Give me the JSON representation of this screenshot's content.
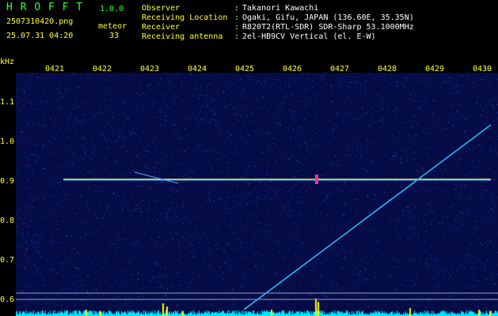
{
  "header": {
    "app_title": "H R O F F T",
    "version": "1.0.0",
    "file_name": "2507310420.png",
    "detection_label": "meteor",
    "timestamp": "25.07.31 04:20",
    "detection_count": "33",
    "info": [
      {
        "key": "Observer",
        "sep": ":",
        "value": "Takanori Kawachi"
      },
      {
        "key": "Receiving Location",
        "sep": ":",
        "value": "Ogaki, Gifu, JAPAN (136.60E, 35.35N)"
      },
      {
        "key": "Receiver",
        "sep": ":",
        "value": "R820T2(RTL-SDR) SDR-Sharp 53.1000MHz"
      },
      {
        "key": "Receiving antenna",
        "sep": ":",
        "value": "2el-HB9CV Vertical (el. E-W)"
      }
    ]
  },
  "axes": {
    "y_unit": "kHz",
    "y_ticks": [
      "1.1",
      "1.0",
      "0.9",
      "0.8",
      "0.7",
      "0.6"
    ],
    "x_ticks": [
      "0421",
      "0422",
      "0423",
      "0424",
      "0425",
      "0426",
      "0427",
      "0428",
      "0429",
      "0430"
    ]
  },
  "colors": {
    "background": "#000000",
    "plot_bg": "#050c45",
    "header_green": "#33ff33",
    "header_yellow": "#ffff33",
    "trace": "#2fb8ff",
    "noise_cyan": "#00e5ff",
    "spike_yellow": "#ffff00"
  }
}
